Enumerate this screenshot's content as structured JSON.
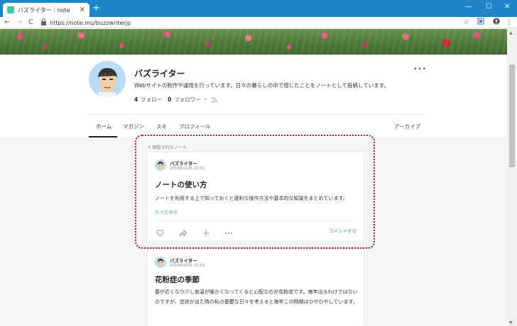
{
  "browser": {
    "tab_title": "バズライター｜note",
    "close_glyph": "×",
    "newtab_glyph": "+",
    "url": "https://note.mu/buzzwriterjp",
    "nav_back": "←",
    "nav_forward": "→",
    "nav_reload": "C",
    "window_min": "—",
    "window_max": "☐",
    "window_close": "✕",
    "star": "☆",
    "menu": "⋮"
  },
  "profile": {
    "name": "バズライター",
    "bio": "Webサイトの制作や運用を行っています。日々の暮らしの中で感じたことをノートとして投稿しています。",
    "following_count": "4",
    "following_label": "フォロー",
    "followers_count": "0",
    "followers_label": "フォロワー",
    "more": "•••"
  },
  "tabs": [
    "ホーム",
    "マガジン",
    "スキ",
    "プロフィール"
  ],
  "archive": "アーカイブ",
  "pinned_label": "✎ 固定されたノート",
  "notes": [
    {
      "author": "バズライター",
      "date": "2019/02/28 02:03",
      "title": "ノートの使い方",
      "excerpt": "ノートを利用する上で知っておくと便利な操作方法や基本的な知識をまとめています。",
      "readmore": "もっとみる",
      "comment": "コメントする"
    },
    {
      "author": "バズライター",
      "date": "2019/03/02 10:58",
      "title": "花粉症の季節",
      "excerpt": "春が近くなり少し気温が暖かくなってくると心配なのが花粉症です。毎年出るわけではないのですが、症状が出た時の私の憂鬱な日々を考えると毎年この時期はひやひやしています。"
    }
  ],
  "colors": {
    "accent_green": "#2ea885",
    "highlight_red": "#d01010",
    "chrome_blue": "#1e86c8"
  },
  "icons": [
    "heart-icon",
    "share-icon",
    "add-icon",
    "more-icon",
    "rss-icon",
    "pin-icon"
  ]
}
